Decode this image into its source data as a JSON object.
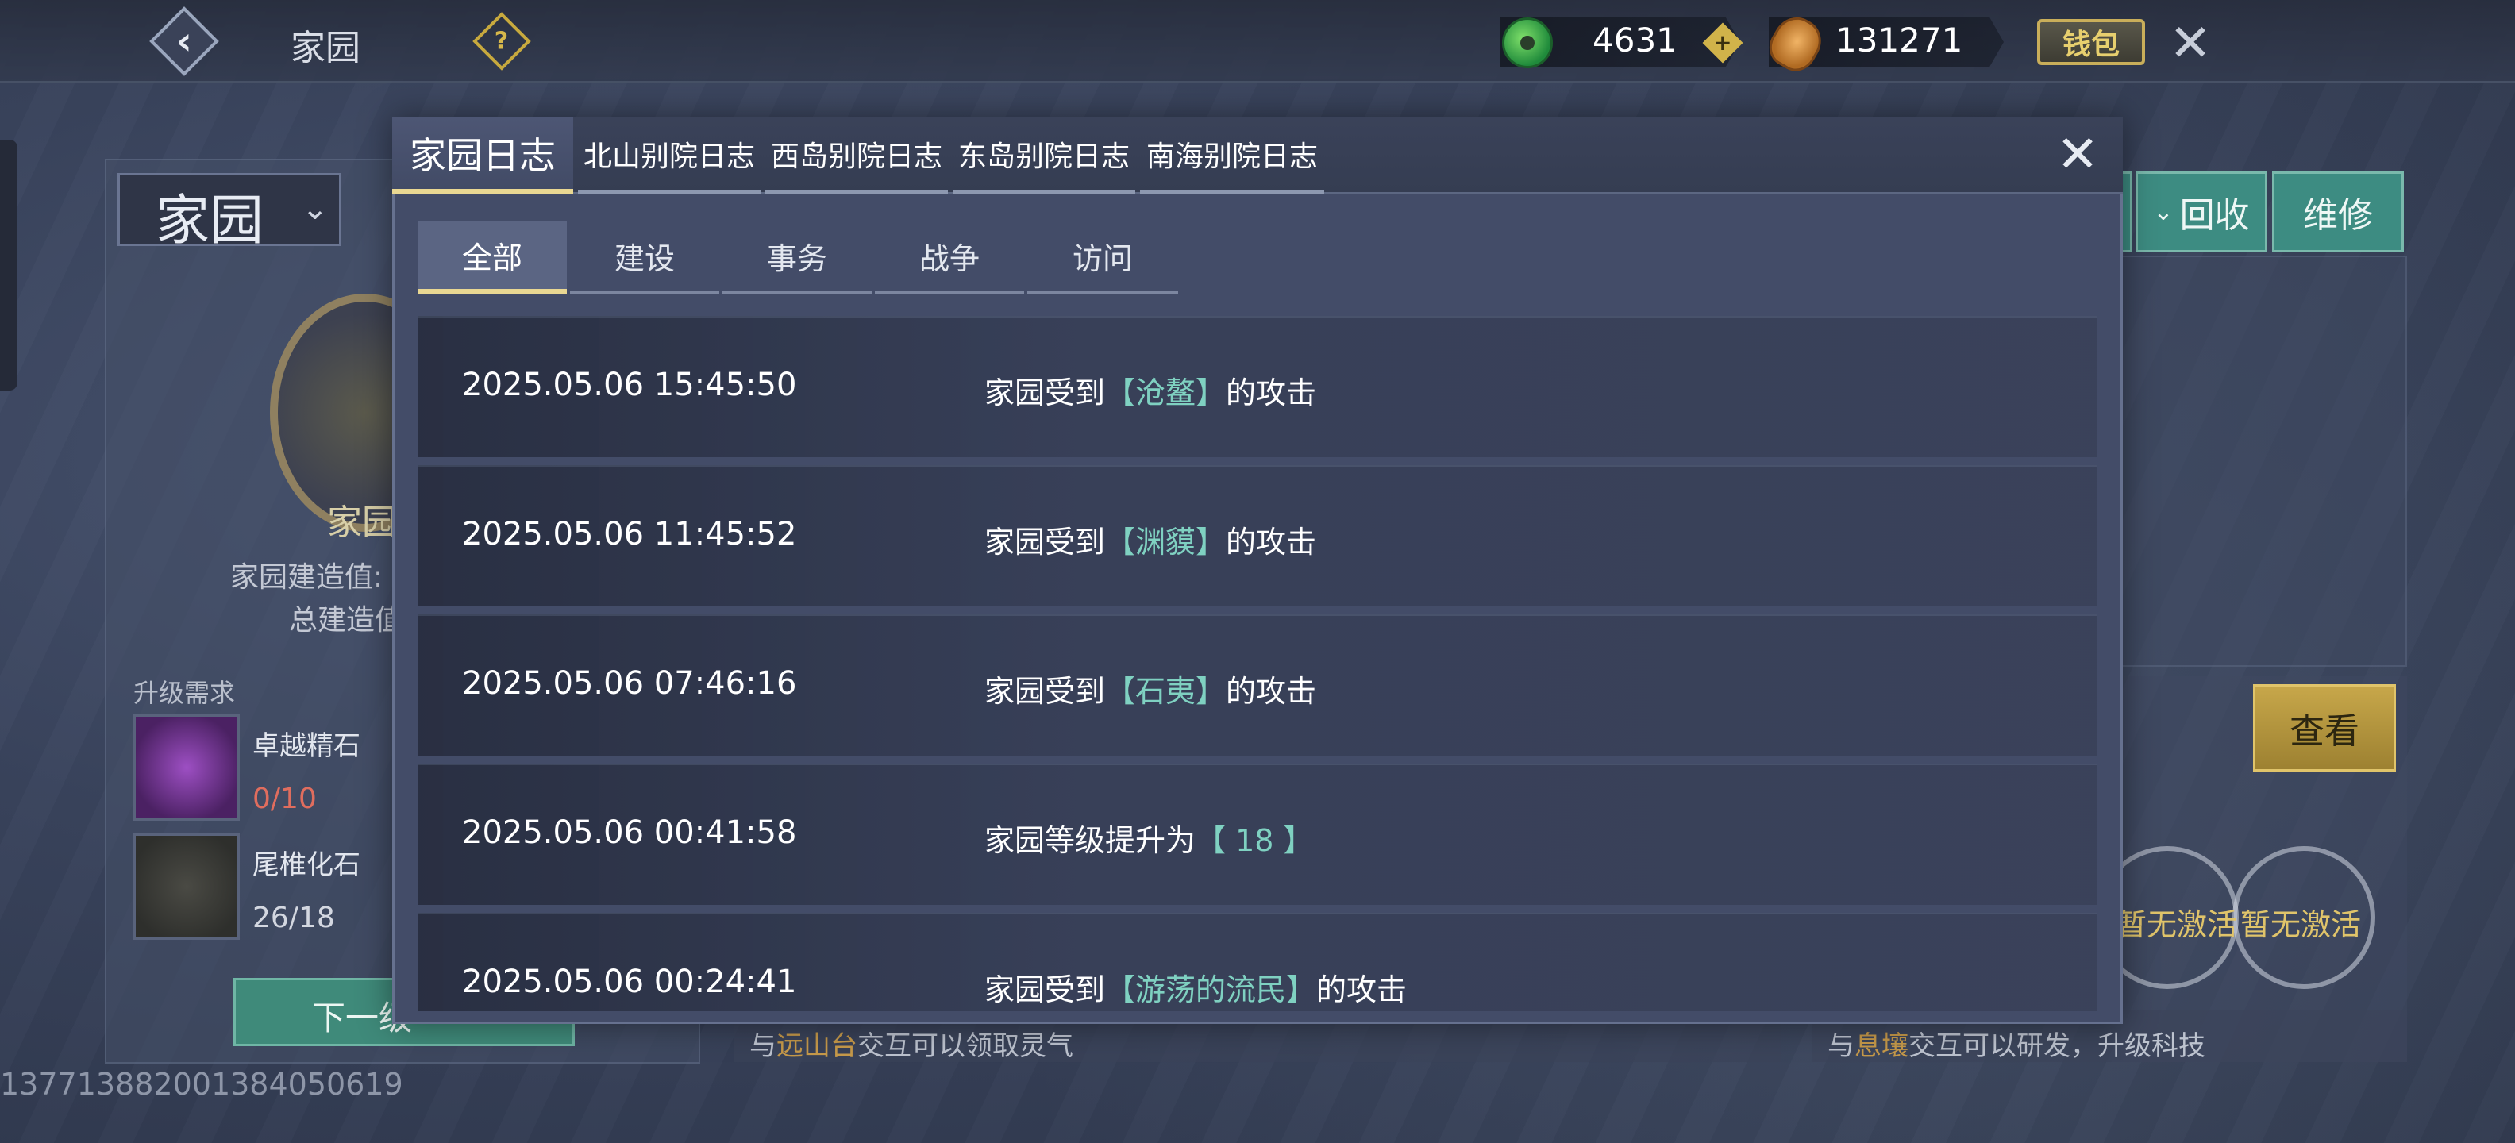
{
  "topbar": {
    "title": "家园",
    "jade_value": "4631",
    "shell_value": "131271",
    "wallet_label": "钱包"
  },
  "left_panel": {
    "home_select": "家园",
    "emblem_text": "家园",
    "build_value_label": "家园建造值:",
    "total_build_label": "总建造值",
    "upgrade_label": "升级需求",
    "items": [
      {
        "name": "卓越精石",
        "count": "0/10"
      },
      {
        "name": "尾椎化石",
        "count": "26/18"
      }
    ],
    "next_button": "下一级",
    "id_text": "1377138820013840506​19"
  },
  "right_panel": {
    "buttons": [
      "",
      "回收",
      "维修"
    ],
    "view_button": "查看",
    "inactive": [
      "暂无激活",
      "暂无激活"
    ]
  },
  "hints": {
    "hint1_prefix": "与",
    "hint1_place": "远山台",
    "hint1_suffix": "交互可以领取灵气",
    "hint2_prefix": "与",
    "hint2_place": "息壤",
    "hint2_suffix": "交互可以研发，升级科技"
  },
  "modal": {
    "tabs": [
      "家园日志",
      "北山别院日志",
      "西岛别院日志",
      "东岛别院日志",
      "南海别院日志"
    ],
    "sub_tabs": [
      "全部",
      "建设",
      "事务",
      "战争",
      "访问"
    ],
    "logs": [
      {
        "time": "2025.05.06 15:45:50",
        "prefix": "家园受到",
        "tag": "【沧鳌】",
        "suffix": "的攻击"
      },
      {
        "time": "2025.05.06 11:45:52",
        "prefix": "家园受到",
        "tag": "【渊貘】",
        "suffix": "的攻击"
      },
      {
        "time": "2025.05.06 07:46:16",
        "prefix": "家园受到",
        "tag": "【石夷】",
        "suffix": "的攻击"
      },
      {
        "time": "2025.05.06 00:41:58",
        "prefix": "家园等级提升为",
        "tag": "【 18 】",
        "suffix": ""
      },
      {
        "time": "2025.05.06 00:24:41",
        "prefix": "家园受到",
        "tag": "【游荡的流民】",
        "suffix": "的攻击"
      }
    ]
  },
  "colors": {
    "accent_tag": "#7fd1c1",
    "tab_underline": "#e9d792",
    "teal_button": "#3d8c82",
    "gold_button": "#c7a74a"
  },
  "icons": [
    "back-icon",
    "help-icon",
    "jade-coin-icon",
    "plus-icon",
    "shell-coin-icon",
    "close-icon",
    "chevron-down-icon"
  ]
}
